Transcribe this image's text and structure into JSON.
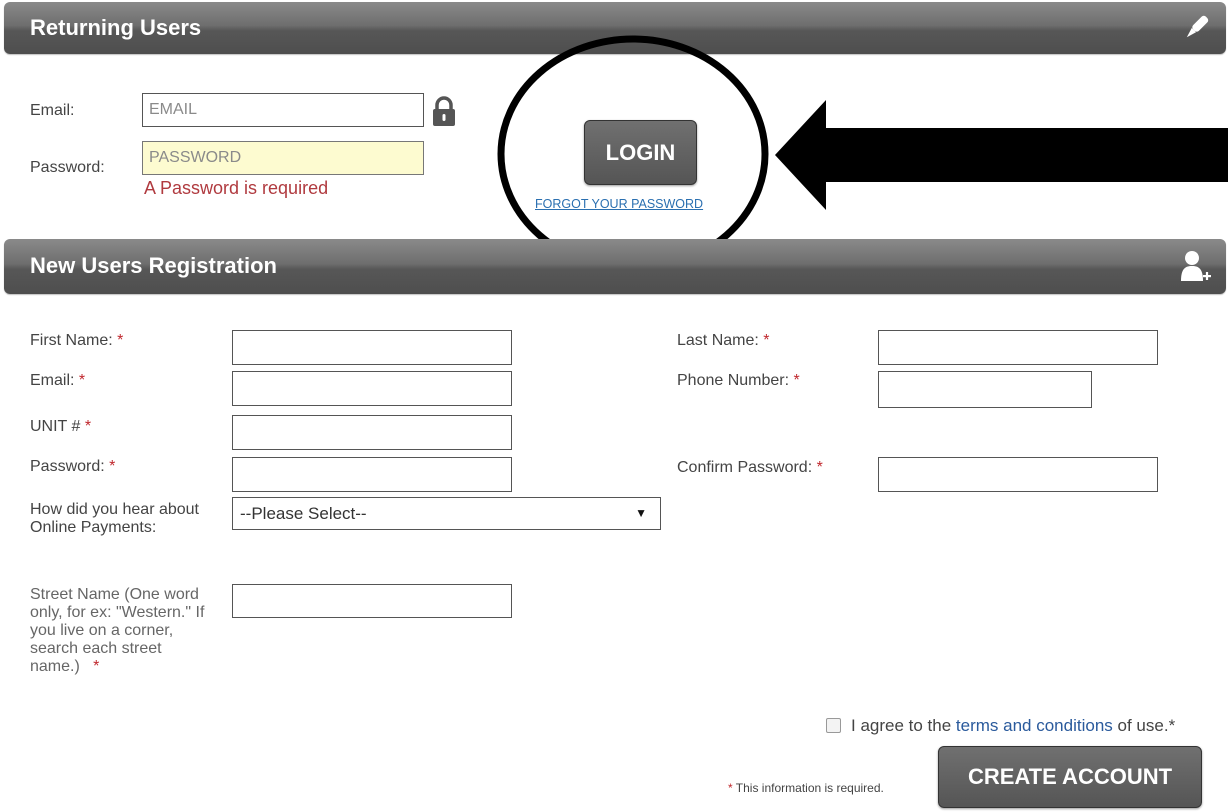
{
  "returning": {
    "title": "Returning Users",
    "icon": "pen-icon",
    "email_label": "Email:",
    "email_placeholder": "EMAIL",
    "password_label": "Password:",
    "password_placeholder": "PASSWORD",
    "password_error": "A Password is required",
    "login_label": "LOGIN",
    "forgot_label": "FORGOT YOUR PASSWORD"
  },
  "registration": {
    "title": "New Users Registration",
    "icon": "add-user-icon",
    "first_name_label": "First Name:",
    "last_name_label": "Last Name:",
    "email_label": "Email:",
    "phone_label": "Phone Number:",
    "unit_label": "UNIT #",
    "password_label": "Password:",
    "confirm_password_label": "Confirm Password:",
    "hear_label": "How did you hear about Online Payments:",
    "hear_selected": "--Please Select--",
    "street_label": "Street Name (One word only, for ex: \"Western.\" If you live on a corner, search each street name.)",
    "required_mark": "*",
    "agree_prefix": "I agree to the",
    "terms_link": "terms and conditions",
    "agree_suffix": "of use.*",
    "required_note": "This information is required.",
    "create_label": "CREATE ACCOUNT"
  },
  "colors": {
    "required": "#c0272d",
    "link": "#2a5a9c",
    "highlight_field": "#fdfbd0"
  }
}
